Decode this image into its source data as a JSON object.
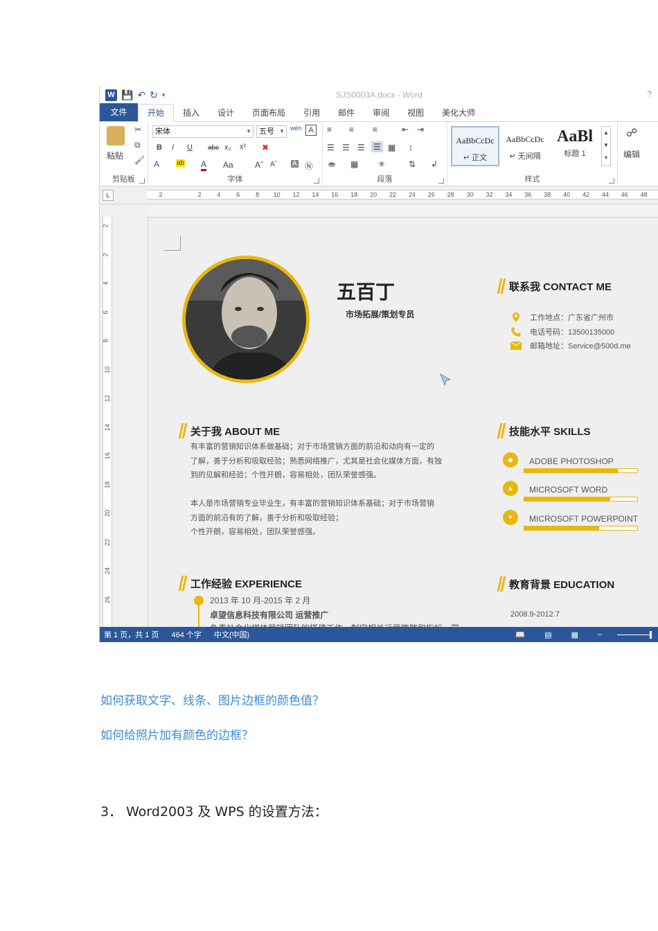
{
  "window": {
    "doc_title": "SJS0003A.docx - Word",
    "help": "?"
  },
  "tabs": [
    "文件",
    "开始",
    "插入",
    "设计",
    "页面布局",
    "引用",
    "邮件",
    "审阅",
    "视图",
    "美化大师"
  ],
  "ribbon": {
    "clipboard": {
      "paste": "粘贴",
      "label": "剪贴板"
    },
    "font": {
      "name": "宋体",
      "size": "五号",
      "label": "字体",
      "bold": "B",
      "italic": "I",
      "underline": "U",
      "strike": "abc",
      "sub": "x₂",
      "sup": "x²",
      "case": "Aa"
    },
    "paragraph": {
      "label": "段落"
    },
    "styles": {
      "label": "样式",
      "items": [
        {
          "sample": "AaBbCcDc",
          "name": "↵ 正文"
        },
        {
          "sample": "AaBbCcDc",
          "name": "↵ 无间隔"
        },
        {
          "sample": "AaBl",
          "name": "标题 1"
        }
      ]
    },
    "editing": {
      "label": "编辑"
    }
  },
  "ruler": {
    "marks": [
      "2",
      "2",
      "4",
      "6",
      "8",
      "10",
      "12",
      "14",
      "16",
      "18",
      "20",
      "22",
      "24",
      "26",
      "28",
      "30",
      "32",
      "34",
      "36",
      "38",
      "40",
      "42",
      "44",
      "46",
      "48"
    ],
    "vmarks": [
      "2",
      "2",
      "4",
      "6",
      "8",
      "10",
      "12",
      "14",
      "16",
      "18",
      "20",
      "22",
      "24",
      "26"
    ]
  },
  "resume": {
    "name": "五百丁",
    "role": "市场拓展/策划专员",
    "contact": {
      "title": "联系我 CONTACT ME",
      "rows": [
        {
          "icon": "location-icon",
          "text": "工作地点：广东省广州市"
        },
        {
          "icon": "phone-icon",
          "text": "电话号码：13500135000"
        },
        {
          "icon": "mail-icon",
          "text": "邮箱地址：Service@500d.me"
        }
      ]
    },
    "about": {
      "title": "关于我 ABOUT ME",
      "p1": [
        "有丰富的营销知识体系做基础；对于市场营销方面的前沿和动向有一定的",
        "了解，善于分析和吸取经验；熟悉网络推广，尤其是社会化媒体方面，有独",
        "到的见解和经验；个性开朗，容易相处，团队荣誉感强。"
      ],
      "p2": [
        "本人是市场营销专业毕业生，有丰富的营销知识体系基础；对于市场营销",
        "方面的前沿有的了解，善于分析和吸取经验；",
        "个性开朗，容易相处，团队荣誉感强。"
      ]
    },
    "skills": {
      "title": "技能水平 SKILLS",
      "items": [
        {
          "name": "ADOBE PHOTOSHOP",
          "level": 0.83
        },
        {
          "name": "MICROSOFT WORD",
          "level": 0.76
        },
        {
          "name": "MICROSOFT POWERPOINT",
          "level": 0.66
        }
      ]
    },
    "experience": {
      "title": "工作经验 EXPERIENCE",
      "period": "2013 年 10 月-2015 年 2 月",
      "company": "卓望信息科技有限公司    运营推广",
      "cut": "负责社会化媒体营销团队的搭建工作，制定相关运营策略和指标，带"
    },
    "education": {
      "title": "教育背景 EDUCATION",
      "period": "2008.9-2012.7"
    }
  },
  "status": {
    "page": "第 1 页，共 1 页",
    "words": "464 个字",
    "lang": "中文(中国)"
  },
  "below": {
    "link1": "如何获取文字、线条、图片边框的颜色值？",
    "link2": "如何给照片加有颜色的边框？",
    "heading": "3．  Word2003 及 WPS 的设置方法："
  },
  "colors": {
    "accent": "#e8b80e",
    "word_blue": "#2b579a",
    "link": "#3d8bd6"
  }
}
